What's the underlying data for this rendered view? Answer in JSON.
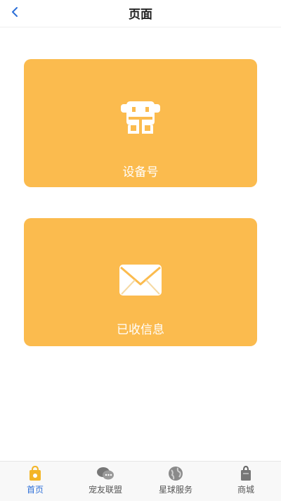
{
  "header": {
    "title": "页面",
    "back_icon": "chevron-left-icon"
  },
  "cards": [
    {
      "label": "设备号",
      "icon": "device-icon"
    },
    {
      "label": "已收信息",
      "icon": "envelope-icon"
    }
  ],
  "tabbar": {
    "items": [
      {
        "label": "首页",
        "icon": "home-bag-icon",
        "active": true
      },
      {
        "label": "宠友联盟",
        "icon": "chat-bubbles-icon",
        "active": false
      },
      {
        "label": "星球服务",
        "icon": "globe-icon",
        "active": false
      },
      {
        "label": "商城",
        "icon": "shopping-bag-icon",
        "active": false
      }
    ]
  },
  "colors": {
    "card": "#fbbb4e",
    "accent": "#2d6fd8",
    "tab_inactive": "#555555"
  }
}
